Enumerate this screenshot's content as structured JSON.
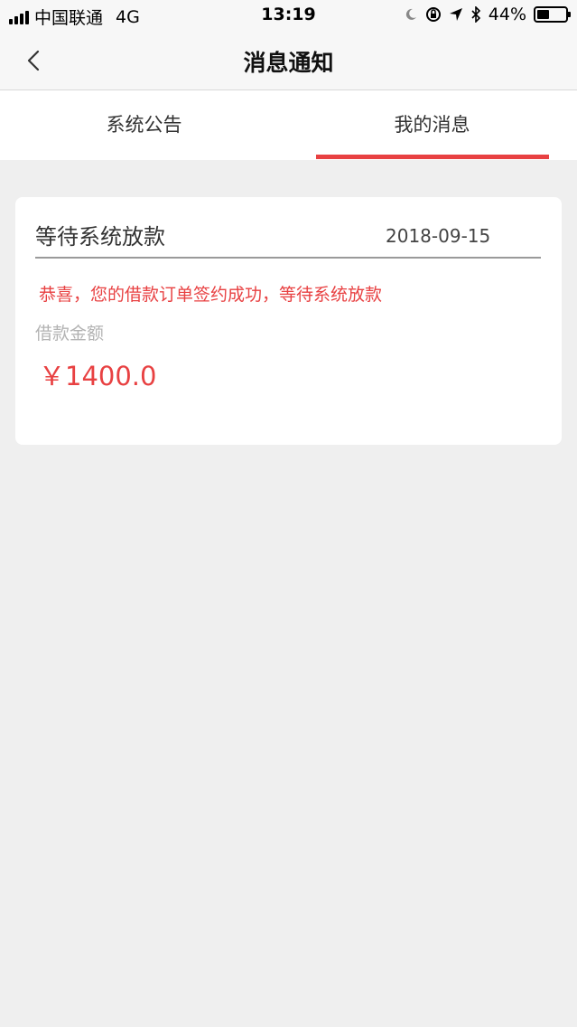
{
  "status_bar": {
    "carrier": "中国联通",
    "network": "4G",
    "time": "13:19",
    "battery": "44%",
    "battery_level": 0.44
  },
  "nav": {
    "title": "消息通知"
  },
  "tabs": [
    {
      "label": "系统公告",
      "active": false
    },
    {
      "label": "我的消息",
      "active": true
    }
  ],
  "colors": {
    "accent": "#e84142",
    "background": "#efefef"
  },
  "messages": [
    {
      "title": "等待系统放款",
      "date": "2018-09-15",
      "content": "恭喜，您的借款订单签约成功，等待系统放款",
      "amount_label": "借款金额",
      "amount": "￥1400.0"
    }
  ]
}
